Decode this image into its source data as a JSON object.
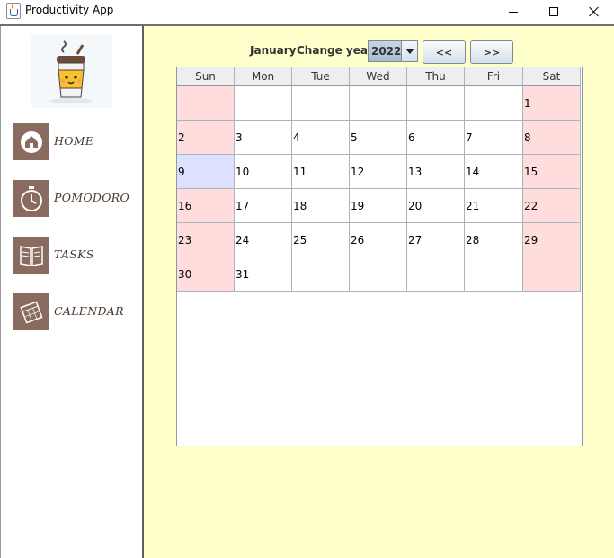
{
  "window": {
    "title": "Productivity App"
  },
  "sidebar": {
    "items": [
      {
        "label": "HOME",
        "icon": "home-icon"
      },
      {
        "label": "POMODORO",
        "icon": "stopwatch-icon"
      },
      {
        "label": "TASKS",
        "icon": "book-icon"
      },
      {
        "label": "CALENDAR",
        "icon": "calendar-icon"
      }
    ]
  },
  "colors": {
    "sidebar_icon_bg": "#8a6b60",
    "main_bg": "#ffffcc",
    "weekend_cell": "#ffdddd",
    "today_cell": "#dde0ff"
  },
  "header": {
    "month": "January",
    "change_year_label": "Change year:",
    "year": "2022",
    "prev_label": "<<",
    "next_label": ">>"
  },
  "calendar": {
    "day_names": [
      "Sun",
      "Mon",
      "Tue",
      "Wed",
      "Thu",
      "Fri",
      "Sat"
    ],
    "weeks": [
      [
        "",
        "",
        "",
        "",
        "",
        "",
        "1"
      ],
      [
        "2",
        "3",
        "4",
        "5",
        "6",
        "7",
        "8"
      ],
      [
        "9",
        "10",
        "11",
        "12",
        "13",
        "14",
        "15"
      ],
      [
        "16",
        "17",
        "18",
        "19",
        "20",
        "21",
        "22"
      ],
      [
        "23",
        "24",
        "25",
        "26",
        "27",
        "28",
        "29"
      ],
      [
        "30",
        "31",
        "",
        "",
        "",
        "",
        ""
      ]
    ],
    "highlighted_day": "9"
  }
}
